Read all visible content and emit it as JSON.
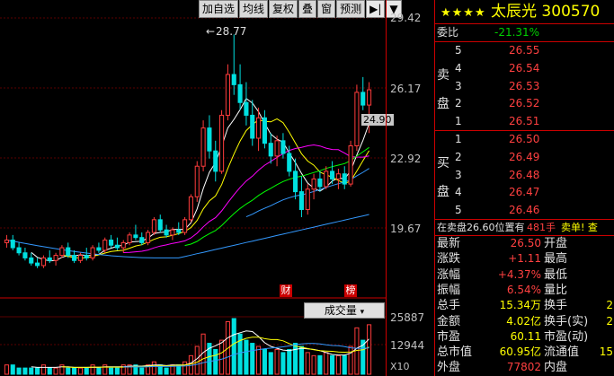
{
  "toolbar": {
    "buttons": [
      "加自选",
      "均线",
      "复权",
      "叠",
      "窗",
      "预测"
    ],
    "arrow_right": "▶|",
    "arrow_down": "▼"
  },
  "price_axis": [
    "29.42",
    "26.17",
    "22.92",
    "19.67"
  ],
  "volume_axis": [
    "25887",
    "12944",
    "X10"
  ],
  "annotations": {
    "high_price": "28.77",
    "current_tag": "24.90",
    "tag_cai": "财",
    "tag_bang": "榜"
  },
  "volume_selector": "成交量",
  "stock": {
    "stars": "★★★★",
    "name": "太辰光 300570"
  },
  "weibi": {
    "label": "委比",
    "value": "-21.31%"
  },
  "sell": {
    "label1": "卖",
    "label2": "盘",
    "levels": [
      {
        "n": "5",
        "price": "26.55"
      },
      {
        "n": "4",
        "price": "26.54"
      },
      {
        "n": "3",
        "price": "26.53"
      },
      {
        "n": "2",
        "price": "26.52"
      },
      {
        "n": "1",
        "price": "26.51"
      }
    ]
  },
  "buy": {
    "label1": "买",
    "label2": "盘",
    "levels": [
      {
        "n": "1",
        "price": "26.50"
      },
      {
        "n": "2",
        "price": "26.49"
      },
      {
        "n": "3",
        "price": "26.48"
      },
      {
        "n": "4",
        "price": "26.47"
      },
      {
        "n": "5",
        "price": "26.46"
      }
    ]
  },
  "notice": {
    "text": "在卖盘26.60位置有",
    "qty": "481手",
    "action": "卖单! 查"
  },
  "stats": [
    {
      "l1": "最新",
      "v1": "26.50",
      "l2": "开盘",
      "v2": ""
    },
    {
      "l1": "涨跌",
      "v1": "+1.11",
      "l2": "最高",
      "v2": ""
    },
    {
      "l1": "涨幅",
      "v1": "+4.37%",
      "l2": "最低",
      "v2": ""
    },
    {
      "l1": "振幅",
      "v1": "6.54%",
      "l2": "量比",
      "v2": ""
    },
    {
      "l1": "总手",
      "v1": "15.34万",
      "l2": "换手",
      "v2": "2"
    },
    {
      "l1": "金额",
      "v1": "4.02亿",
      "l2": "换手(实)",
      "v2": "2"
    },
    {
      "l1": "市盈",
      "v1": "60.11",
      "l2": "市盈(动)",
      "v2": ""
    },
    {
      "l1": "总市值",
      "v1": "60.95亿",
      "l2": "流通值",
      "v2": "15"
    },
    {
      "l1": "外盘",
      "v1": "77802",
      "l2": "内盘",
      "v2": ""
    }
  ],
  "chart_data": {
    "type": "candlestick",
    "ylim": [
      18.5,
      29.42
    ],
    "candles": [
      [
        20.6,
        20.9,
        20.4,
        20.7
      ],
      [
        20.7,
        20.9,
        20.3,
        20.4
      ],
      [
        20.4,
        20.6,
        20.1,
        20.2
      ],
      [
        20.2,
        20.4,
        19.9,
        20.0
      ],
      [
        20.0,
        20.2,
        19.7,
        19.8
      ],
      [
        19.8,
        20.0,
        19.6,
        19.7
      ],
      [
        19.7,
        20.1,
        19.6,
        20.0
      ],
      [
        20.0,
        20.3,
        19.8,
        19.9
      ],
      [
        19.9,
        20.2,
        19.7,
        20.1
      ],
      [
        20.1,
        20.5,
        20.0,
        20.4
      ],
      [
        20.4,
        20.6,
        20.0,
        20.1
      ],
      [
        20.1,
        20.3,
        19.8,
        19.9
      ],
      [
        19.9,
        20.2,
        19.8,
        20.1
      ],
      [
        20.1,
        20.4,
        19.9,
        20.0
      ],
      [
        20.0,
        20.5,
        19.9,
        20.4
      ],
      [
        20.4,
        20.6,
        20.2,
        20.3
      ],
      [
        20.3,
        20.8,
        20.2,
        20.7
      ],
      [
        20.7,
        20.9,
        20.4,
        20.5
      ],
      [
        20.5,
        20.8,
        20.3,
        20.4
      ],
      [
        20.4,
        20.7,
        20.2,
        20.6
      ],
      [
        20.6,
        21.0,
        20.5,
        20.9
      ],
      [
        20.9,
        21.3,
        20.7,
        20.8
      ],
      [
        20.8,
        21.0,
        20.5,
        20.6
      ],
      [
        20.6,
        21.1,
        20.5,
        21.0
      ],
      [
        21.0,
        21.6,
        20.9,
        21.5
      ],
      [
        21.5,
        21.7,
        21.0,
        21.1
      ],
      [
        21.1,
        21.3,
        20.8,
        20.9
      ],
      [
        20.9,
        21.2,
        20.7,
        21.1
      ],
      [
        21.1,
        21.4,
        20.9,
        21.0
      ],
      [
        21.0,
        21.6,
        20.9,
        21.5
      ],
      [
        21.5,
        22.5,
        21.4,
        22.4
      ],
      [
        22.4,
        23.8,
        22.2,
        23.6
      ],
      [
        23.6,
        25.4,
        23.4,
        25.1
      ],
      [
        25.1,
        25.6,
        23.9,
        24.2
      ],
      [
        24.2,
        24.6,
        23.0,
        23.4
      ],
      [
        23.4,
        25.8,
        23.3,
        25.6
      ],
      [
        25.6,
        27.6,
        25.4,
        27.2
      ],
      [
        27.2,
        28.77,
        26.4,
        26.8
      ],
      [
        26.8,
        27.6,
        25.8,
        26.1
      ],
      [
        26.1,
        26.9,
        25.2,
        25.6
      ],
      [
        25.6,
        26.2,
        24.4,
        24.7
      ],
      [
        24.7,
        25.9,
        24.2,
        25.5
      ],
      [
        25.5,
        25.8,
        24.3,
        24.5
      ],
      [
        24.5,
        24.9,
        23.7,
        24.0
      ],
      [
        24.0,
        24.8,
        23.6,
        24.6
      ],
      [
        24.6,
        24.9,
        23.9,
        24.1
      ],
      [
        24.1,
        24.4,
        23.2,
        23.4
      ],
      [
        23.4,
        23.9,
        22.3,
        22.6
      ],
      [
        22.6,
        23.2,
        21.6,
        21.9
      ],
      [
        21.9,
        22.9,
        21.7,
        22.7
      ],
      [
        22.7,
        23.3,
        22.3,
        23.1
      ],
      [
        23.1,
        23.4,
        22.6,
        22.8
      ],
      [
        22.8,
        23.6,
        22.7,
        23.4
      ],
      [
        23.4,
        23.8,
        22.9,
        23.1
      ],
      [
        23.1,
        23.5,
        22.7,
        23.3
      ],
      [
        23.3,
        23.6,
        22.7,
        22.9
      ],
      [
        22.9,
        24.6,
        22.8,
        24.4
      ],
      [
        24.4,
        26.8,
        24.2,
        26.5
      ],
      [
        26.5,
        27.1,
        25.8,
        26.0
      ],
      [
        26.0,
        26.9,
        24.9,
        26.6
      ]
    ],
    "volumes": [
      3,
      3,
      2,
      2,
      2,
      2,
      3,
      2,
      2,
      3,
      2,
      2,
      2,
      2,
      3,
      2,
      3,
      2,
      2,
      3,
      3,
      3,
      2,
      3,
      4,
      3,
      2,
      3,
      3,
      4,
      6,
      9,
      13,
      10,
      8,
      11,
      17,
      18,
      13,
      11,
      10,
      9,
      8,
      7,
      8,
      7,
      8,
      10,
      9,
      7,
      6,
      6,
      7,
      6,
      6,
      6,
      9,
      15,
      11,
      16
    ],
    "vmax": 25887
  }
}
